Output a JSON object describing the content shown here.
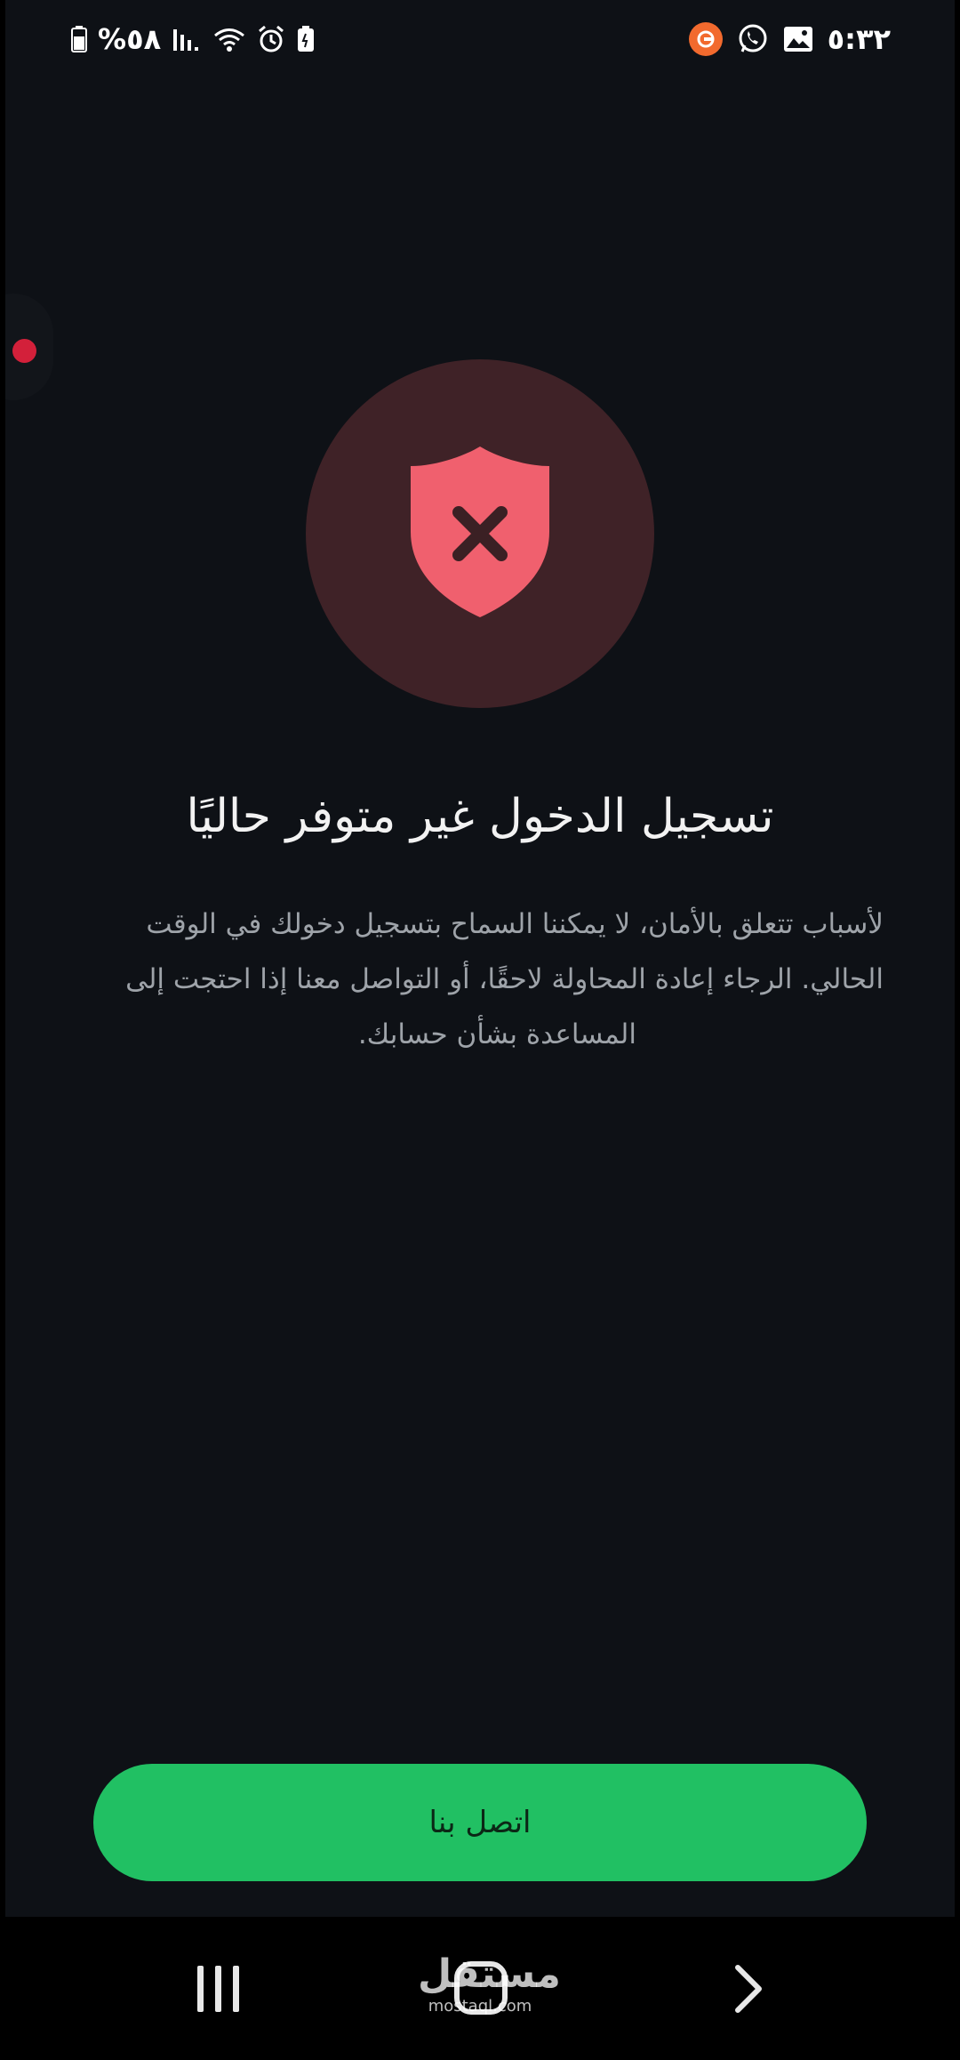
{
  "status_bar": {
    "battery_percent": "%٥٨",
    "time": "٥:٣٢",
    "icons_left": [
      "battery-icon",
      "signal-icon",
      "wifi-icon",
      "alarm-icon",
      "battery-saver-icon"
    ],
    "icons_right": [
      "app-notification-icon",
      "whatsapp-icon",
      "gallery-icon"
    ]
  },
  "hero": {
    "icon": "shield-x-icon",
    "circle_color": "#3f2227",
    "shield_color": "#f0606e"
  },
  "title": "تسجيل الدخول غير متوفر حاليًا",
  "body_lines": [
    "لأسباب تتعلق بالأمان، لا يمكننا السماح بتسجيل دخولك في الوقت",
    "الحالي. الرجاء إعادة المحاولة لاحقًا، أو التواصل معنا إذا احتجت إلى",
    "المساعدة بشأن حسابك."
  ],
  "contact_button": {
    "label": "اتصل بنا",
    "color": "#21c063"
  },
  "nav_bar": {
    "icons": [
      "recents-icon",
      "home-icon",
      "back-icon"
    ]
  },
  "watermark": {
    "arabic": "مستقل",
    "latin": "mostaql.com"
  }
}
